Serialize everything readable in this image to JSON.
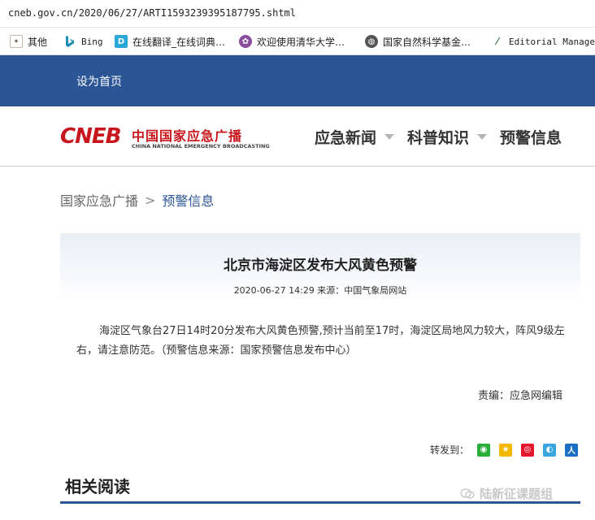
{
  "browser": {
    "address": "cneb.gov.cn/2020/06/27/ARTI1593239395187795.shtml",
    "bookmarks": [
      {
        "label": "其他",
        "icon": "school-seal-icon"
      },
      {
        "label": "Bing",
        "icon": "bing-icon"
      },
      {
        "label": "在线翻译_在线词典…",
        "icon": "dict-icon"
      },
      {
        "label": "欢迎使用清华大学…",
        "icon": "tsinghua-icon"
      },
      {
        "label": "国家自然科学基金…",
        "icon": "globe-icon"
      },
      {
        "label": "Editorial Manager®",
        "icon": "editorial-manager-icon"
      }
    ]
  },
  "topbar": {
    "set_home": "设为首页"
  },
  "header": {
    "logo_mark": "CNEB",
    "logo_cn": "中国国家应急广播",
    "logo_en": "CHINA NATIONAL EMERGENCY BROADCASTING",
    "nav": [
      {
        "label": "应急新闻"
      },
      {
        "label": "科普知识"
      },
      {
        "label": "预警信息"
      }
    ]
  },
  "breadcrumb": {
    "home": "国家应急广播",
    "sep": ">",
    "current": "预警信息"
  },
  "article": {
    "title": "北京市海淀区发布大风黄色预警",
    "meta": "2020-06-27 14:29 来源：中国气象局网站",
    "body": "海淀区气象台27日14时20分发布大风黄色预警,预计当前至17时，海淀区局地风力较大，阵风9级左右，请注意防范。（预警信息来源：国家预警信息发布中心）",
    "editor": "责编：应急网编辑"
  },
  "share": {
    "label": "转发到：",
    "targets": [
      "wechat-icon",
      "qzone-icon",
      "weibo-icon",
      "tencent-weibo-icon",
      "renren-icon"
    ]
  },
  "related": {
    "title": "相关阅读"
  },
  "watermark": {
    "text": "陆新征课题组"
  },
  "colors": {
    "brand_blue": "#2c5596",
    "brand_red": "#c8161d"
  }
}
